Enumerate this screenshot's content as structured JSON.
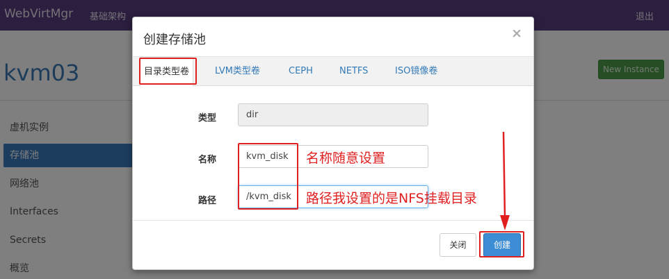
{
  "navbar": {
    "brand": "WebVirtMgr",
    "infrastructure": "基础架构",
    "logout": "退出"
  },
  "page": {
    "title": "kvm03",
    "new_instance": "New Instance"
  },
  "sidebar": {
    "items": [
      {
        "label": "虚机实例"
      },
      {
        "label": "存储池"
      },
      {
        "label": "网络池"
      },
      {
        "label": "Interfaces"
      },
      {
        "label": "Secrets"
      },
      {
        "label": "概览"
      }
    ]
  },
  "modal": {
    "title": "创建存储池",
    "close_symbol": "×",
    "tabs": [
      {
        "label": "目录类型卷"
      },
      {
        "label": "LVM类型卷"
      },
      {
        "label": "CEPH"
      },
      {
        "label": "NETFS"
      },
      {
        "label": "ISO镜像卷"
      }
    ],
    "fields": {
      "type": {
        "label": "类型",
        "value": "dir"
      },
      "name": {
        "label": "名称",
        "value": "kvm_disk"
      },
      "path": {
        "label": "路径",
        "value": "/kvm_disk"
      }
    },
    "buttons": {
      "close": "关闭",
      "create": "创建"
    }
  },
  "annotations": {
    "name_note": "名称随意设置",
    "path_note": "路径我设置的是NFS挂载目录",
    "color": "#e02020"
  }
}
